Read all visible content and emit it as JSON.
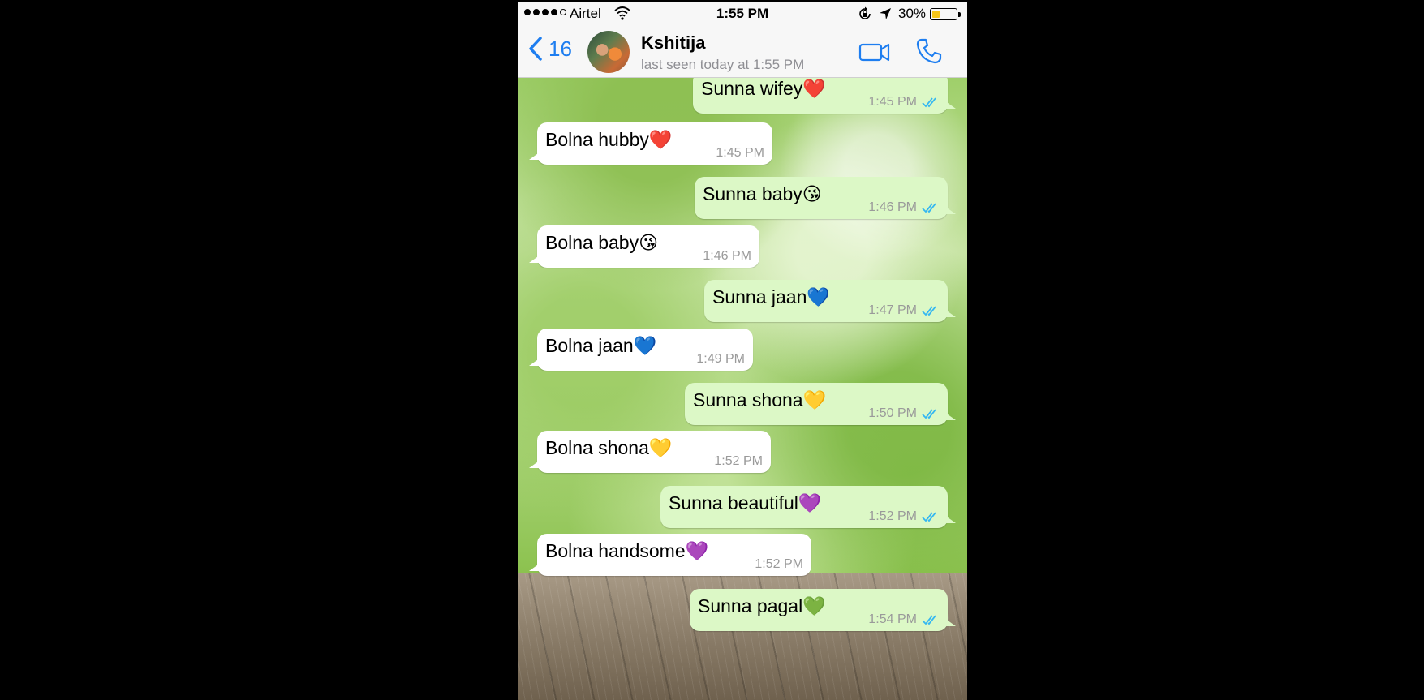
{
  "status_bar": {
    "carrier": "Airtel",
    "time": "1:55 PM",
    "battery_percent": "30%",
    "battery_level": 0.3,
    "signal_bars_filled": 4
  },
  "header": {
    "back_count": "16",
    "contact_name": "Kshitija",
    "last_seen": "last seen today at 1:55 PM"
  },
  "messages": [
    {
      "direction": "out",
      "text": "Sunna wifey❤️",
      "time": "1:45 PM"
    },
    {
      "direction": "in",
      "text": "Bolna hubby❤️",
      "time": "1:45 PM"
    },
    {
      "direction": "out",
      "text": "Sunna baby😘",
      "time": "1:46 PM"
    },
    {
      "direction": "in",
      "text": "Bolna baby😘",
      "time": "1:46 PM"
    },
    {
      "direction": "out",
      "text": "Sunna jaan💙",
      "time": "1:47 PM"
    },
    {
      "direction": "in",
      "text": "Bolna jaan💙",
      "time": "1:49 PM"
    },
    {
      "direction": "out",
      "text": "Sunna shona💛",
      "time": "1:50 PM"
    },
    {
      "direction": "in",
      "text": "Bolna shona💛",
      "time": "1:52 PM"
    },
    {
      "direction": "out",
      "text": "Sunna beautiful💜",
      "time": "1:52 PM"
    },
    {
      "direction": "in",
      "text": "Bolna handsome💜",
      "time": "1:52 PM"
    },
    {
      "direction": "out",
      "text": "Sunna pagal💚",
      "time": "1:54 PM"
    }
  ],
  "colors": {
    "accent": "#1e7ef0",
    "outgoing_bubble": "#dcf8c6",
    "incoming_bubble": "#ffffff",
    "read_ticks": "#34b7f1"
  }
}
